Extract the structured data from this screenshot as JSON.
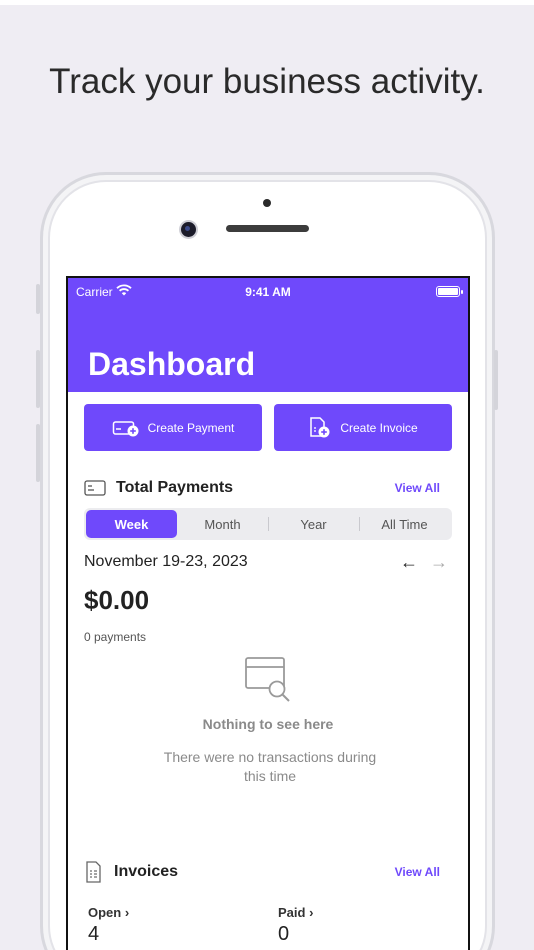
{
  "headline": "Track your business activity.",
  "status_bar": {
    "carrier": "Carrier",
    "time": "9:41 AM"
  },
  "app": {
    "title": "Dashboard"
  },
  "actions": {
    "create_payment": "Create Payment",
    "create_invoice": "Create Invoice"
  },
  "payments": {
    "title": "Total Payments",
    "view_all": "View All",
    "tabs": [
      "Week",
      "Month",
      "Year",
      "All Time"
    ],
    "selected_tab": "Week",
    "date_range": "November 19-23, 2023",
    "prev_arrow": "←",
    "next_arrow": "→",
    "total": "$0.00",
    "count": "0 payments",
    "empty_title": "Nothing to see here",
    "empty_text": "There were no transactions during this time"
  },
  "invoices": {
    "title": "Invoices",
    "view_all": "View All",
    "open_label": "Open",
    "open_value": "4",
    "paid_label": "Paid",
    "paid_value": "0"
  },
  "colors": {
    "accent": "#6f49fb",
    "background": "#efedf3"
  },
  "icons": [
    "wifi-icon",
    "battery-icon",
    "card-add-icon",
    "invoice-add-icon",
    "card-icon",
    "invoice-icon",
    "empty-search-icon",
    "chevron-right-icon"
  ]
}
